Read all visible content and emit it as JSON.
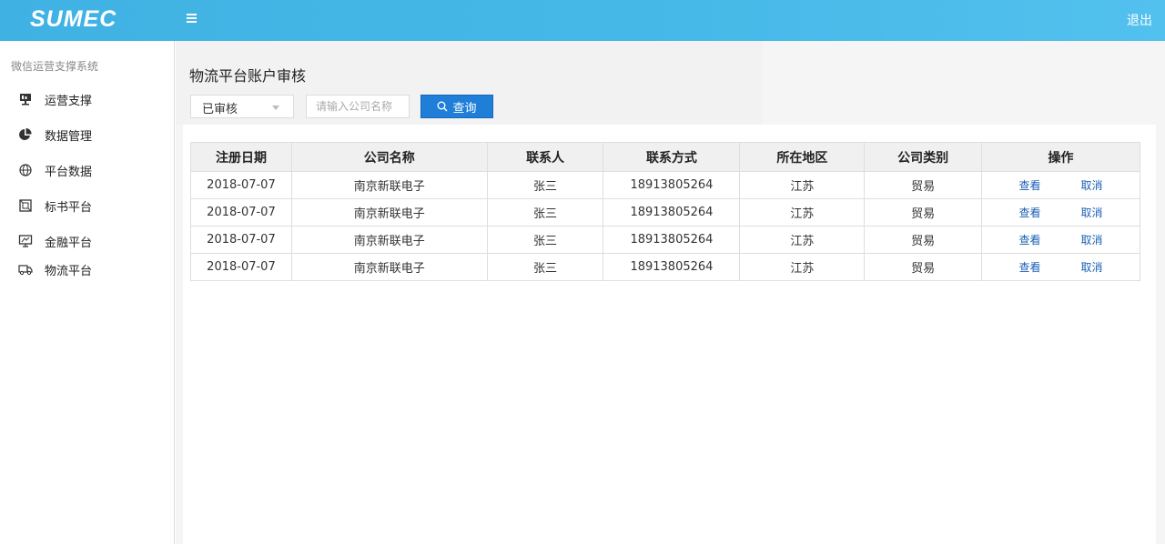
{
  "header": {
    "logo": "SUMEC",
    "logout_label": "退出"
  },
  "sidebar": {
    "system_title": "微信运营支撑系统",
    "items": [
      {
        "label": "运营支撑",
        "icon": "presentation-board-icon"
      },
      {
        "label": "数据管理",
        "icon": "pie-chart-icon"
      },
      {
        "label": "平台数据",
        "icon": "globe-icon"
      },
      {
        "label": "标书平台",
        "icon": "frame-icon"
      },
      {
        "label": "金融平台",
        "icon": "monitor-icon"
      },
      {
        "label": "物流平台",
        "icon": "truck-icon"
      }
    ]
  },
  "page": {
    "title": "物流平台账户审核"
  },
  "filters": {
    "status_selected": "已审核",
    "company_placeholder": "请输入公司名称",
    "query_label": "查询"
  },
  "table": {
    "headers": [
      "注册日期",
      "公司名称",
      "联系人",
      "联系方式",
      "所在地区",
      "公司类别",
      "操作"
    ],
    "rows": [
      {
        "date": "2018-07-07",
        "company": "南京新联电子",
        "contact": "张三",
        "phone": "18913805264",
        "region": "江苏",
        "category": "贸易",
        "view": "查看",
        "cancel": "取消"
      },
      {
        "date": "2018-07-07",
        "company": "南京新联电子",
        "contact": "张三",
        "phone": "18913805264",
        "region": "江苏",
        "category": "贸易",
        "view": "查看",
        "cancel": "取消"
      },
      {
        "date": "2018-07-07",
        "company": "南京新联电子",
        "contact": "张三",
        "phone": "18913805264",
        "region": "江苏",
        "category": "贸易",
        "view": "查看",
        "cancel": "取消"
      },
      {
        "date": "2018-07-07",
        "company": "南京新联电子",
        "contact": "张三",
        "phone": "18913805264",
        "region": "江苏",
        "category": "贸易",
        "view": "查看",
        "cancel": "取消"
      }
    ]
  },
  "colors": {
    "header": "#47b9e8",
    "primary_button": "#1e7ed8",
    "link": "#1a5fb4"
  }
}
